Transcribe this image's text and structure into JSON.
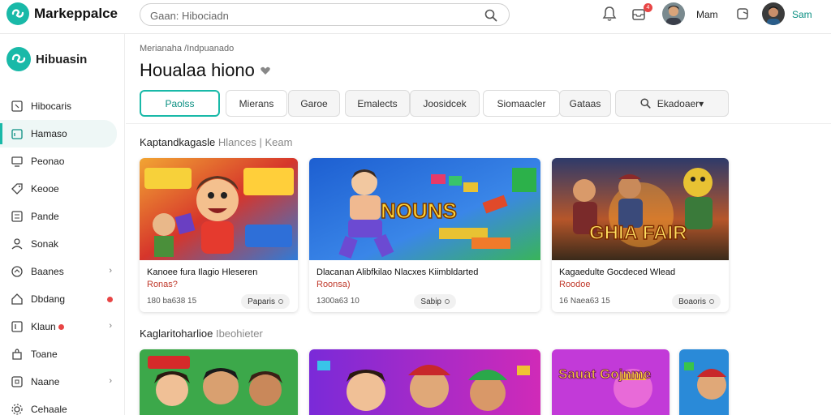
{
  "app": {
    "name": "Markeppalce",
    "accent": "#19b9a8"
  },
  "search": {
    "placeholder": "Gaan: Hibociadn"
  },
  "header": {
    "notification_badge": "4",
    "user1_name": "Mam",
    "user2_name": "Sam"
  },
  "sidebar": {
    "brand": "Hibuasin",
    "items": [
      {
        "label": "Hibocaris",
        "icon": "box-icon"
      },
      {
        "label": "Hamaso",
        "icon": "calendar-icon",
        "active": true
      },
      {
        "label": "Peonao",
        "icon": "monitor-icon"
      },
      {
        "label": "Keooe",
        "icon": "tag-icon"
      },
      {
        "label": "Pande",
        "icon": "list-icon"
      },
      {
        "label": "Sonak",
        "icon": "person-icon"
      },
      {
        "label": "Baanes",
        "icon": "chat-icon",
        "chevron": "›"
      },
      {
        "label": "Dbdang",
        "icon": "home-icon",
        "dot": true
      },
      {
        "label": "Klaun",
        "icon": "document-icon",
        "chevron": "›",
        "dot_inline": true
      },
      {
        "label": "Toane",
        "icon": "bag-icon"
      },
      {
        "label": "Naane",
        "icon": "grid-icon",
        "chevron": "›"
      },
      {
        "label": "Cehaale",
        "icon": "gear-icon"
      }
    ]
  },
  "main": {
    "breadcrumb": "Merianaha /Indpuanado",
    "title": "Houalaa hiono",
    "tabs": [
      {
        "label": "Paolss",
        "active": true
      },
      {
        "label": "Mierans"
      },
      {
        "label": "Garoe"
      },
      {
        "label": "Emalects"
      },
      {
        "label": "Joosidcek"
      },
      {
        "label": "Siomaacler"
      },
      {
        "label": "Gataas"
      },
      {
        "label": "Ekadoaer▾"
      }
    ],
    "section1": {
      "title": "Kaptandkagasle",
      "subtitle": "Hlances | Keam"
    },
    "section2": {
      "title": "Kaglaritoharlioe",
      "subtitle": "Ibeohieter"
    },
    "cards": [
      {
        "title": "Kanoee fura Ilagio Hleseren",
        "price": "Ronas?",
        "meta": "180 ba638 15",
        "pill": "Paparis"
      },
      {
        "title": "Dlacanan Alibfkilao Nlacxes Kiimbldarted",
        "price": "Roonsa)",
        "meta": "1300a63 10",
        "pill": "Sabip",
        "thumb_text": "NOUNS"
      },
      {
        "title": "Kagaedulte Gocdeced Wlead",
        "price": "Roodoe",
        "meta": "16 Naea63 15",
        "pill": "Boaoris",
        "thumb_text": "GHIA FAIR"
      }
    ],
    "bottom_cards": [
      {
        "label": "Sauat Gojnme"
      }
    ]
  }
}
